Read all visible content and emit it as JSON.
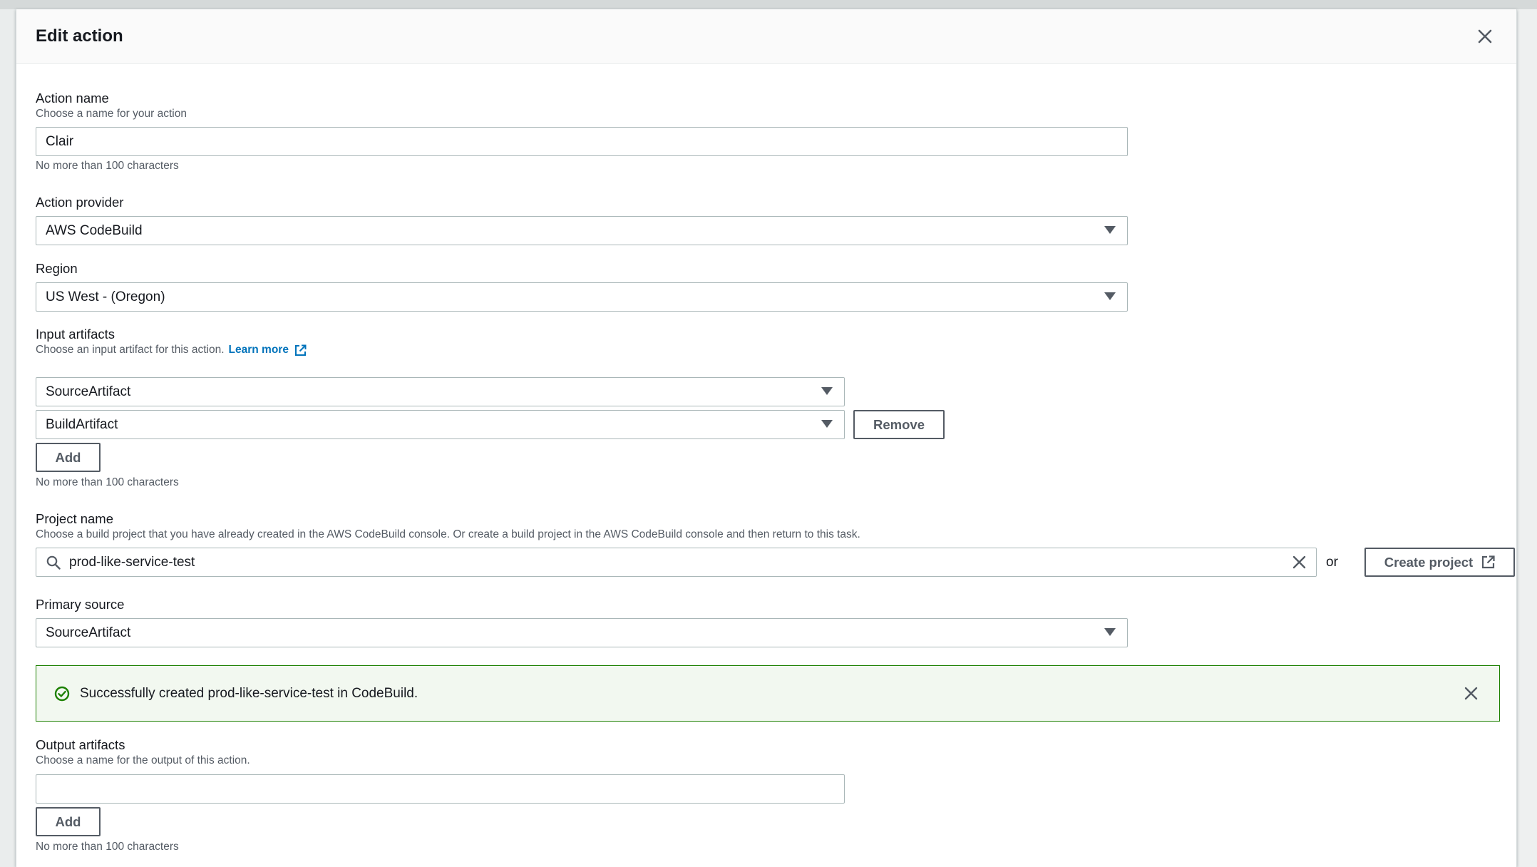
{
  "modal": {
    "title": "Edit action",
    "close_icon": "close-icon"
  },
  "action_name": {
    "label": "Action name",
    "description": "Choose a name for your action",
    "value": "Clair",
    "constraint": "No more than 100 characters"
  },
  "action_provider": {
    "label": "Action provider",
    "value": "AWS CodeBuild"
  },
  "region": {
    "label": "Region",
    "value": "US West - (Oregon)"
  },
  "input_artifacts": {
    "label": "Input artifacts",
    "description": "Choose an input artifact for this action.",
    "learn_more": "Learn more",
    "items": [
      "SourceArtifact",
      "BuildArtifact"
    ],
    "remove_label": "Remove",
    "add_label": "Add",
    "constraint": "No more than 100 characters"
  },
  "project_name": {
    "label": "Project name",
    "description": "Choose a build project that you have already created in the AWS CodeBuild console. Or create a build project in the AWS CodeBuild console and then return to this task.",
    "value": "prod-like-service-test",
    "or_text": "or",
    "create_label": "Create project"
  },
  "primary_source": {
    "label": "Primary source",
    "value": "SourceArtifact"
  },
  "alert": {
    "message": "Successfully created prod-like-service-test in CodeBuild.",
    "color": "#1d8102"
  },
  "output_artifacts": {
    "label": "Output artifacts",
    "description": "Choose a name for the output of this action.",
    "value": "",
    "add_label": "Add",
    "constraint": "No more than 100 characters"
  },
  "colors": {
    "link": "#0073bb",
    "success": "#1d8102",
    "border": "#aab7b8",
    "text": "#16191f"
  }
}
